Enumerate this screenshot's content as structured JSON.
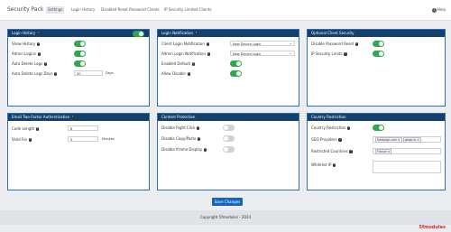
{
  "header": {
    "title": "Security Pack",
    "tabs": [
      "Settings",
      "Login History",
      "Disabled Reset Password Clients",
      "IP Security Limited Clients"
    ],
    "help_label": "Help"
  },
  "panels": {
    "login_history": {
      "title": "Login History",
      "header_toggle": true,
      "show_history": {
        "label": "Show History",
        "on": true
      },
      "admin_logins": {
        "label": "Admin Logins",
        "on": true
      },
      "auto_delete": {
        "label": "Auto Delete Logs",
        "on": true
      },
      "auto_delete_days": {
        "label": "Auto Delete Logs Days",
        "value": "30",
        "unit": "Days"
      }
    },
    "login_notification": {
      "title": "Login Notification",
      "client_notification": {
        "label": "Client Login Notification",
        "value": "New Device Login"
      },
      "admin_notification": {
        "label": "Admin Login Notification",
        "value": "New Device Login"
      },
      "enabled_default": {
        "label": "Enabled Default",
        "on": true
      },
      "allow_disable": {
        "label": "Allow Disable",
        "on": true
      }
    },
    "optional_client_security": {
      "title": "Optional Client Security",
      "disable_password_reset": {
        "label": "Disable Password Reset",
        "on": true
      },
      "ip_security_limits": {
        "label": "IP Security Limits",
        "on": true
      }
    },
    "email_2fa": {
      "title": "Email Two-Factor Authentication",
      "code_length": {
        "label": "Code Length",
        "value": "6"
      },
      "valid_for": {
        "label": "Valid For",
        "value": "5",
        "unit": "Minutes"
      }
    },
    "content_protection": {
      "title": "Content Protection",
      "disable_right_click": {
        "label": "Disable Right Click",
        "on": false
      },
      "disable_copy_paste": {
        "label": "Disable Copy/Paste",
        "on": false
      },
      "disable_iframe": {
        "label": "Disable Iframe Display",
        "on": false
      }
    },
    "country_restriction": {
      "title": "Country Restriction",
      "enabled": {
        "label": "Country Restriction",
        "on": true
      },
      "geo_providers": {
        "label": "GEO Providers",
        "chips": [
          "freeipapi.com",
          "geoip.io"
        ]
      },
      "restricted_countries": {
        "label": "Restricted Countries",
        "chips": [
          "France"
        ]
      },
      "whitelist_ip": {
        "label": "Whitelist IP",
        "value": ""
      }
    }
  },
  "save_label": "Save Changes",
  "footer": "Copyright 5fmodules - 2024",
  "brand": "5fmodules",
  "colors": {
    "accent": "#14406e",
    "toggle_on": "#2fa84f",
    "button": "#1565c0"
  }
}
